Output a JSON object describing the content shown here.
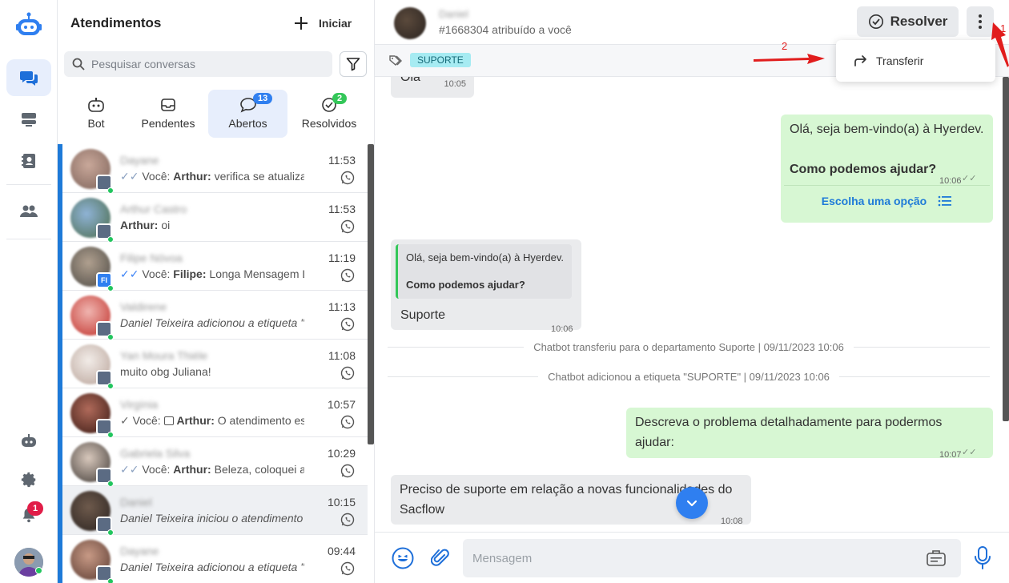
{
  "app": {
    "notifications_count": "1"
  },
  "list": {
    "title": "Atendimentos",
    "start_label": "Iniciar",
    "search_placeholder": "Pesquisar conversas",
    "tabs": [
      {
        "label": "Bot",
        "badge": ""
      },
      {
        "label": "Pendentes",
        "badge": ""
      },
      {
        "label": "Abertos",
        "badge": "13"
      },
      {
        "label": "Resolvidos",
        "badge": "2"
      }
    ],
    "conversations": [
      {
        "name": "Dayane",
        "time": "11:53",
        "you": "Você:",
        "sender": "Arthur:",
        "text": " verifica se atualiza"
      },
      {
        "name": "Arthur Castro",
        "time": "11:53",
        "you": "",
        "sender": "Arthur:",
        "text": " oi"
      },
      {
        "name": "Filipe Nóvoa",
        "time": "11:19",
        "you": "Você:",
        "sender": "Filipe:",
        "text": " Longa Mensagem Longa Mensagem"
      },
      {
        "name": "Valdirene",
        "time": "11:13",
        "you": "",
        "sender": "",
        "text": "Daniel Teixeira adicionou a etiqueta \"Pro..."
      },
      {
        "name": "Yan Moura Thiéle",
        "time": "11:08",
        "you": "",
        "sender": "",
        "text": "muito obg Juliana!"
      },
      {
        "name": "Virgínia",
        "time": "10:57",
        "you": "Você:",
        "sender": "Arthur:",
        "text": " O atendimento estava parado"
      },
      {
        "name": "Gabriela Silva",
        "time": "10:29",
        "you": "Você:",
        "sender": "Arthur:",
        "text": " Beleza, coloquei aqui para vocês"
      },
      {
        "name": "Daniel",
        "time": "10:15",
        "you": "",
        "sender": "",
        "text": "Daniel Teixeira iniciou o atendimento"
      },
      {
        "name": "Dayane",
        "time": "09:44",
        "you": "",
        "sender": "",
        "text": "Daniel Teixeira adicionou a etiqueta \"Pro..."
      }
    ]
  },
  "chat": {
    "contact_name": "Daniel",
    "subtitle": "#1668304 atribuído a você",
    "resolve_label": "Resolver",
    "tag": "SUPORTE",
    "menu_item": "Transferir",
    "messages": {
      "m1": {
        "text": "Olá",
        "time": "10:05"
      },
      "m2": {
        "line1": "Olá, seja bem-vindo(a) à Hyerdev.",
        "line2": "Como podemos ajudar?",
        "time": "10:06",
        "action": "Escolha uma opção"
      },
      "m3": {
        "quote1": "Olá, seja bem-vindo(a) à Hyerdev.",
        "quote2": "Como podemos ajudar?",
        "text": "Suporte",
        "time": "10:06"
      },
      "sys1": "Chatbot transferiu para o departamento Suporte | 09/11/2023 10:06",
      "sys2": "Chatbot adicionou a etiqueta \"SUPORTE\" | 09/11/2023 10:06",
      "m4": {
        "line1": "Descreva o problema detalhadamente para podermos",
        "line2": "ajudar:",
        "time": "10:07"
      },
      "m5": {
        "line1": "Preciso de suporte em relação a novas funcionalidades do",
        "line2": "Sacflow",
        "time": "10:08"
      }
    },
    "composer_placeholder": "Mensagem"
  },
  "annotations": {
    "one": "1",
    "two": "2"
  },
  "colors": {
    "accent": "#1e7ad8",
    "outgoing": "#d7f7d3",
    "incoming": "#eaebed",
    "badge_blue": "#2f7ff0",
    "badge_green": "#34c759",
    "annotation_red": "#e11d1d"
  }
}
